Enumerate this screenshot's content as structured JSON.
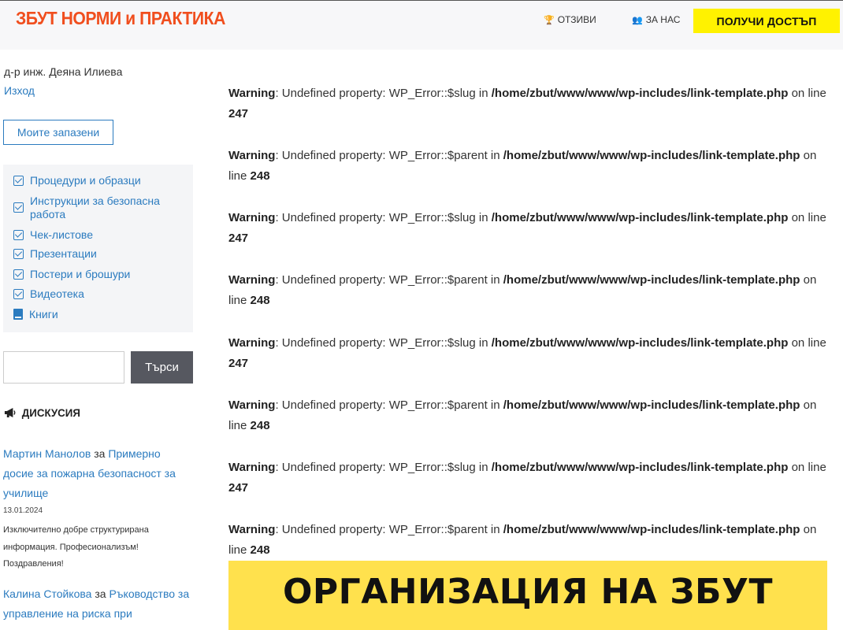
{
  "header": {
    "logo": "ЗБУТ НОРМИ и ПРАКТИКА",
    "nav": [
      {
        "label": "ОТЗИВИ",
        "icon": "trophy-icon"
      },
      {
        "label": "ЗА НАС",
        "icon": "people-icon"
      }
    ],
    "cta_label": "ПОЛУЧИ ДОСТЪП",
    "cta_color": "#fff200",
    "logo_color": "#f04e1e"
  },
  "sidebar": {
    "user_name": "д-р инж. Деяна Илиева",
    "logout_label": "Изход",
    "saved_button_label": "Моите запазени",
    "menu": [
      {
        "label": "Процедури и образци",
        "icon": "checkbox-icon"
      },
      {
        "label": "Инструкции за безопасна работа",
        "icon": "checkbox-icon"
      },
      {
        "label": "Чек-листове",
        "icon": "checkbox-icon"
      },
      {
        "label": "Презентации",
        "icon": "checkbox-icon"
      },
      {
        "label": "Постери и брошури",
        "icon": "checkbox-icon"
      },
      {
        "label": "Видеотека",
        "icon": "checkbox-icon"
      },
      {
        "label": "Книги",
        "icon": "book-icon"
      }
    ],
    "search": {
      "value": "",
      "button_label": "Търси"
    },
    "discussion": {
      "title": "ДИСКУСИЯ",
      "comments": [
        {
          "author": "Мартин Манолов",
          "connector": "за",
          "post": "Примерно досие за пожарна безопасност за училище",
          "date": "13.01.2024",
          "text": "Изключително добре структурирана информация. Професионализъм! Поздравления!"
        },
        {
          "author": "Калина Стойкова",
          "connector": "за",
          "post": "Ръководство за управление на риска при",
          "date": "",
          "text": ""
        }
      ]
    }
  },
  "main": {
    "warnings": [
      {
        "label": "Warning",
        "message": ": Undefined property: WP_Error::$slug in ",
        "file": "/home/zbut/www/www/wp-includes/link-template.php",
        "on": " on line ",
        "line": "247"
      },
      {
        "label": "Warning",
        "message": ": Undefined property: WP_Error::$parent in ",
        "file": "/home/zbut/www/www/wp-includes/link-template.php",
        "on": " on line ",
        "line": "248"
      },
      {
        "label": "Warning",
        "message": ": Undefined property: WP_Error::$slug in ",
        "file": "/home/zbut/www/www/wp-includes/link-template.php",
        "on": " on line ",
        "line": "247"
      },
      {
        "label": "Warning",
        "message": ": Undefined property: WP_Error::$parent in ",
        "file": "/home/zbut/www/www/wp-includes/link-template.php",
        "on": " on line ",
        "line": "248"
      },
      {
        "label": "Warning",
        "message": ": Undefined property: WP_Error::$slug in ",
        "file": "/home/zbut/www/www/wp-includes/link-template.php",
        "on": " on line ",
        "line": "247"
      },
      {
        "label": "Warning",
        "message": ": Undefined property: WP_Error::$parent in ",
        "file": "/home/zbut/www/www/wp-includes/link-template.php",
        "on": " on line ",
        "line": "248"
      },
      {
        "label": "Warning",
        "message": ": Undefined property: WP_Error::$slug in ",
        "file": "/home/zbut/www/www/wp-includes/link-template.php",
        "on": " on line ",
        "line": "247"
      },
      {
        "label": "Warning",
        "message": ": Undefined property: WP_Error::$parent in ",
        "file": "/home/zbut/www/www/wp-includes/link-template.php",
        "on": " on line ",
        "line": "248"
      }
    ],
    "banner": {
      "title": "ОРГАНИЗАЦИЯ НА ЗБУТ",
      "color": "#ffe14d"
    }
  }
}
